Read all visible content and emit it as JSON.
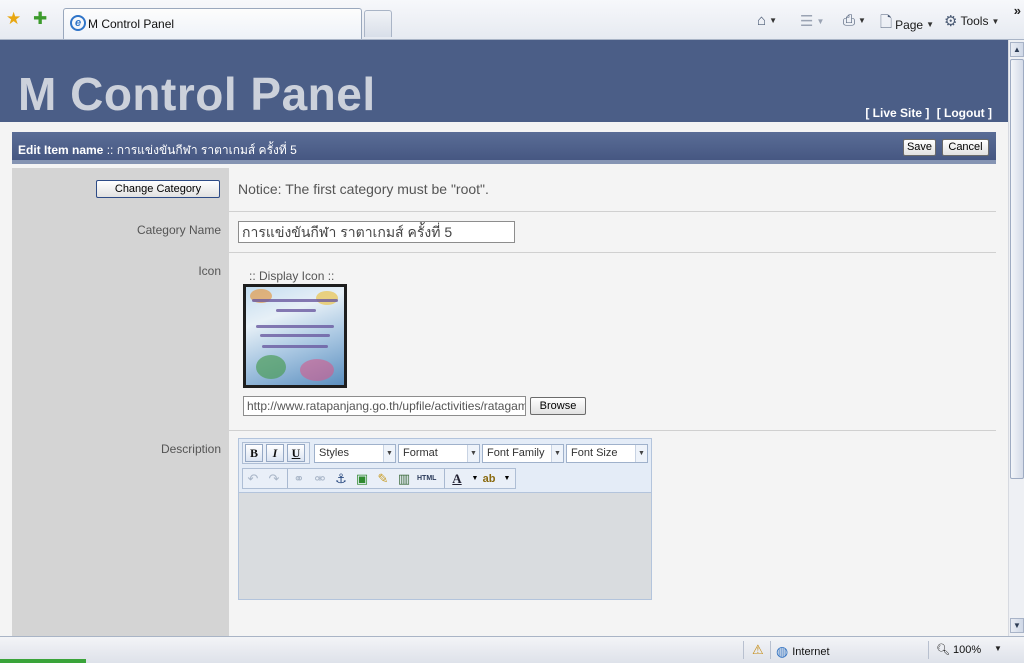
{
  "browser": {
    "tab_title": "M Control Panel",
    "commands": {
      "page": "Page",
      "tools": "Tools"
    },
    "status": {
      "zone": "Internet",
      "zoom": "100%"
    }
  },
  "header": {
    "title": "M Control Panel",
    "live_site": "[ Live Site ]",
    "logout": "[ Logout ]"
  },
  "edit_bar": {
    "label": "Edit Item name",
    "separator": " :: ",
    "item_name": "การแข่งขันกีฬา ราตาเกมส์ ครั้งที่ 5",
    "save": "Save",
    "cancel": "Cancel"
  },
  "form": {
    "change_category_button": "Change Category",
    "notice": "Notice: The first category must be \"root\".",
    "category_name_label": "Category Name",
    "category_name_value": "การแข่งขันกีฬา ราตาเกมส์ ครั้งที่ 5",
    "icon_label": "Icon",
    "display_icon_label": "::  Display Icon  ::",
    "icon_url": "http://www.ratapanjang.go.th/upfile/activities/ratagames",
    "browse_button": "Browse",
    "description_label": "Description"
  },
  "editor": {
    "bold": "B",
    "italic": "I",
    "underline": "U",
    "styles": "Styles",
    "format": "Format",
    "font_family": "Font Family",
    "font_size": "Font Size",
    "html": "HTML"
  }
}
